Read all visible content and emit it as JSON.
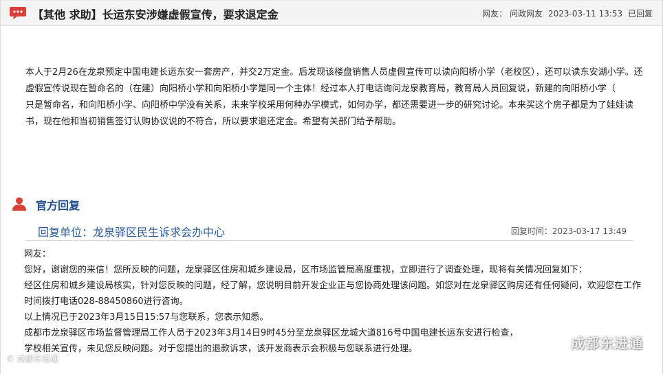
{
  "header": {
    "title": "【其他 求助】长运东安涉嫌虚假宣传，要求退定金",
    "user_label": "网友：",
    "user_name": "问政网友",
    "datetime": "2023-03-11 13:53",
    "status": "已回复",
    "icon": "speech-bubble-icon",
    "accent_color": "#d9403a"
  },
  "post": {
    "paragraphs": [
      "本人于2月26在龙泉预定中国电建长运东安一套房产，并交2万定金。后发现该楼盘销售人员虚假宣传可以读向阳桥小学（老校区），还可以读东安湖小学。还虚假宣传说现在暂命名的（在建）向阳桥小学和向阳桥小学是同一个主体！经过本人打电话询问龙泉教育局，教育局人员回复说，新建的向阳桥小学（",
      "只是暂命名，和向阳桥小学、向阳桥中学没有关系，未来学校采用何种办学模式，如何办学，都还需要进一步的研究讨论。本来买这个房子都是为了娃娃读书，现在他和当初销售签订认购协议说的不符合，所以要求退还定金。希望有关部门给予帮助。"
    ]
  },
  "official_reply": {
    "heading": "官方回复",
    "icon": "person-icon",
    "unit_label": "回复单位：",
    "unit_name": "龙泉驿区民生诉求会办中心",
    "time_label": "回复时间：",
    "time_value": "2023-03-17 13:49",
    "accent_color": "#1f4e8c",
    "paragraphs": [
      "网友：",
      "您好，谢谢您的来信！您所反映的问题，龙泉驿区住房和城乡建设局，区市场监管局高度重视，立即进行了调查处理，现将有关情况回复如下：",
      "经区住房和城乡建设局核实，针对您反映的问题，经了解，您说明目前开发企业正与您协商处理该问题。如您对在龙泉驿区购房还有任何疑问，欢迎您在工作时间拨打电话028-88450860进行咨询。",
      "以上情况已于2023年3月15日15:57与您联系，您表示知悉。",
      "成都市龙泉驿区市场监督管理局工作人员于2023年3月14日9时45分至龙泉驿区龙城大道816号中国电建长运东安进行检查，",
      "学校相关宣传，未见您反映问题。对于您提出的退款诉求，该开发商表示会积极与您联系进行处理。"
    ]
  },
  "watermarks": {
    "right": "成都东进通",
    "left": "© 成都东进通"
  }
}
